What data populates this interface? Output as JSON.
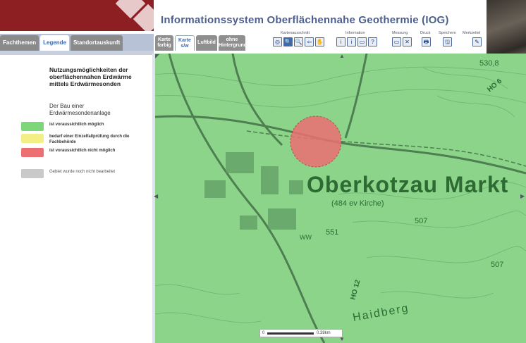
{
  "header": {
    "title": "Informationssystem Oberflächennahe Geothermie (IOG)"
  },
  "sidebar": {
    "tabs": [
      {
        "label": "Fachthemen",
        "active": false
      },
      {
        "label": "Legende",
        "active": true
      },
      {
        "label": "Standortauskunft",
        "active": false
      }
    ],
    "legend": {
      "title": "Nutzungsmöglichkeiten der oberflächennahen Erdwärme mittels Erdwärmesonden",
      "subtitle": "Der Bau einer Erdwärmesondenanlage",
      "items": [
        {
          "label": "ist voraussichtlich möglich",
          "color": "#7ed67a"
        },
        {
          "label": "bedarf einer Einzelfallprüfung durch die Fachbehörde",
          "color": "#f3ef86"
        },
        {
          "label": "ist voraussichtlich nicht möglich",
          "color": "#ec6f72"
        },
        {
          "label": "Gebiet wurde noch nicht bearbeitet",
          "color": "#c9c9c9"
        }
      ]
    }
  },
  "map_tabs": [
    {
      "label": "Karte farbig",
      "active": false
    },
    {
      "label": "Karte s/w",
      "active": true
    },
    {
      "label": "Luftbild",
      "active": false
    },
    {
      "label": "ohne Hintergrund",
      "active": false
    }
  ],
  "toolbar": {
    "groups": {
      "kartenausschnitt": "Kartenausschnitt",
      "information": "Information",
      "messung": "Messung",
      "druck": "Druck",
      "speichern": "Speichern",
      "merkzettel": "Merkzettel"
    },
    "tool_icons": {
      "full-extent": "◎",
      "zoom-in": "🔍",
      "zoom-out": "🔍",
      "back": "⇦",
      "pan": "✋",
      "info": "i",
      "info-area": "i",
      "info-rect": "▭",
      "info-query": "?",
      "measure": "▭",
      "clear": "✕",
      "print": "🖶",
      "save": "🖫",
      "note": "✎"
    }
  },
  "map": {
    "labels": {
      "town": "Oberkotzau Markt",
      "church": "(484 ev Kirche)",
      "hill": "Haidberg",
      "road1": "HO 6",
      "road2": "HO 12",
      "elev_top": "530,8",
      "elev_551": "551",
      "elev_507": "507",
      "elev_507b": "507",
      "ww": "WW"
    },
    "scale": {
      "zero": "0",
      "distance": "0.38km"
    },
    "colors": {
      "possible": "#8cd48a",
      "not_possible": "#ec6f72",
      "road": "#5a8a5c",
      "label": "#2d6b33"
    }
  }
}
